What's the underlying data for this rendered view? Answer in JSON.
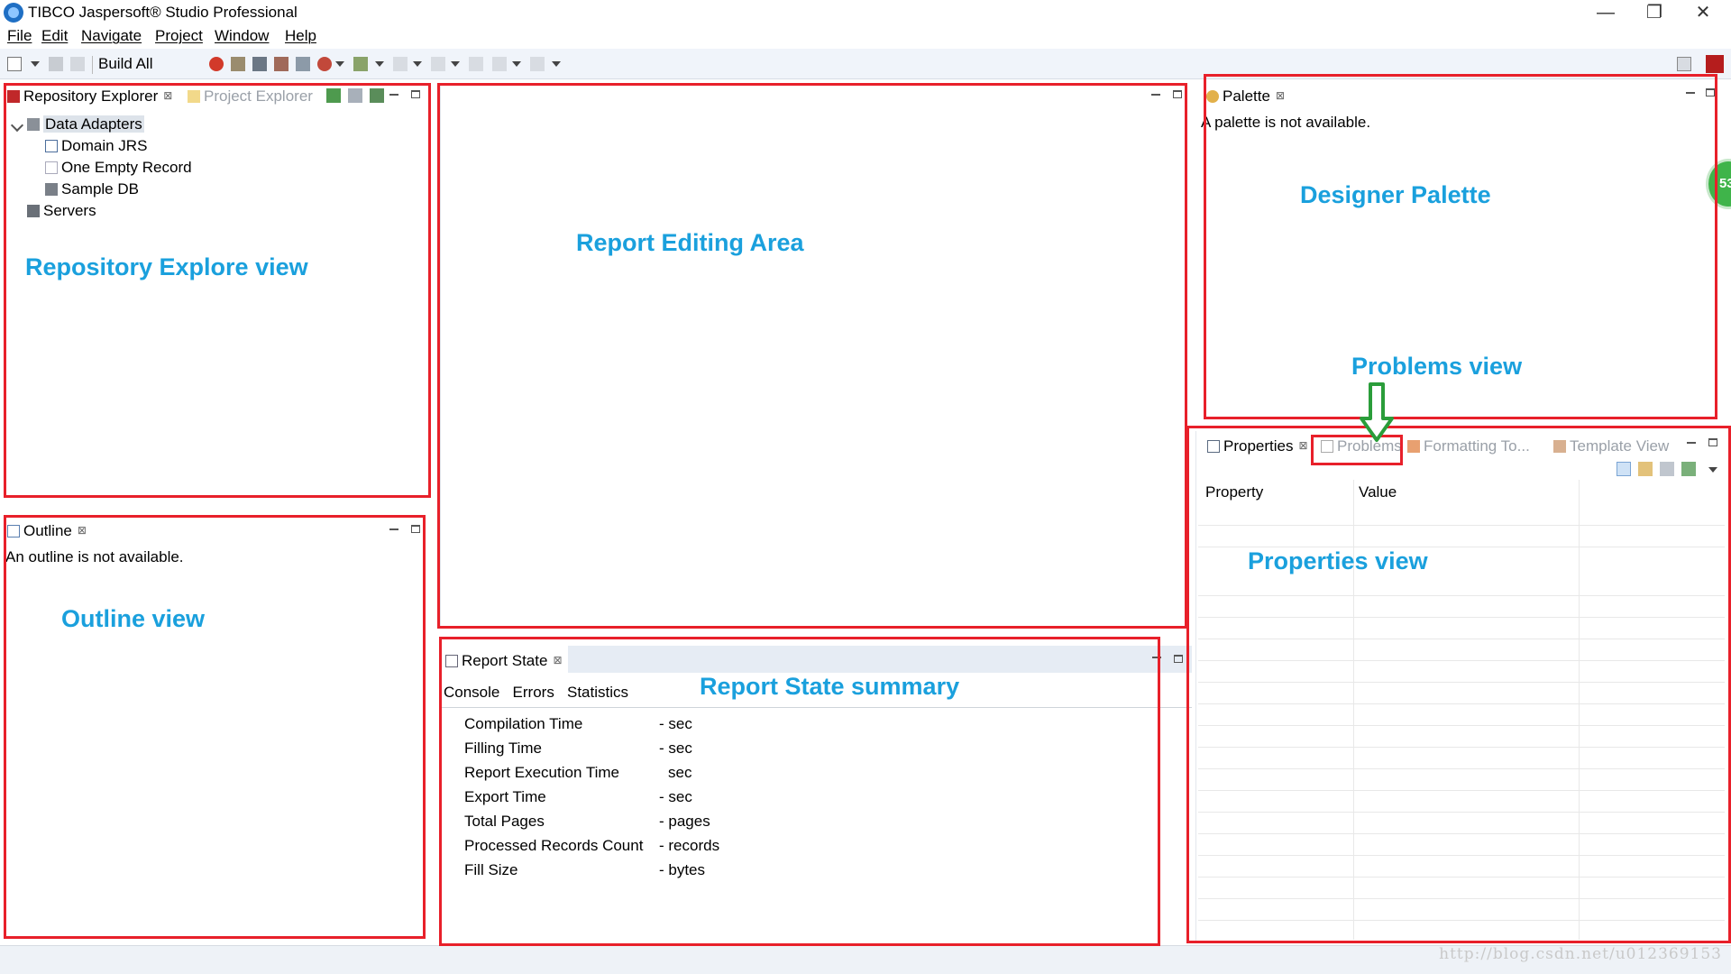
{
  "window": {
    "title": "TIBCO Jaspersoft® Studio Professional",
    "controls": {
      "minimize": "—",
      "restore": "❐",
      "close": "✕"
    }
  },
  "menu": [
    "File",
    "Edit",
    "Navigate",
    "Project",
    "Window",
    "Help"
  ],
  "toolbar": {
    "build_all": "Build All"
  },
  "repository": {
    "tabs": {
      "active": "Repository Explorer",
      "inactive": "Project Explorer"
    },
    "tree": {
      "root": "Data Adapters",
      "children": [
        "Domain JRS",
        "One Empty Record",
        "Sample DB"
      ],
      "servers": "Servers"
    }
  },
  "outline": {
    "tab": "Outline",
    "message": "An outline is not available."
  },
  "palette": {
    "tab": "Palette",
    "message": "A palette is not available."
  },
  "report_state": {
    "tab": "Report State",
    "subtabs": [
      "Console",
      "Errors",
      "Statistics"
    ],
    "rows": [
      {
        "label": "Compilation Time",
        "value": "- sec"
      },
      {
        "label": "Filling Time",
        "value": "- sec"
      },
      {
        "label": "Report Execution Time",
        "value": "sec"
      },
      {
        "label": "Export Time",
        "value": "- sec"
      },
      {
        "label": "Total Pages",
        "value": "- pages"
      },
      {
        "label": "Processed Records Count",
        "value": "- records"
      },
      {
        "label": "Fill Size",
        "value": "- bytes"
      }
    ]
  },
  "properties": {
    "tabs": [
      "Properties",
      "Problems",
      "Formatting To...",
      "Template View"
    ],
    "columns": [
      "Property",
      "Value"
    ]
  },
  "annotations": {
    "repository": "Repository Explore view",
    "editing": "Report Editing Area",
    "palette": "Designer Palette",
    "problems": "Problems view",
    "outline": "Outline view",
    "report_state": "Report State summary",
    "properties": "Properties view"
  },
  "floating_badge": "53",
  "watermark": "http://blog.csdn.net/u012369153",
  "colors": {
    "annotation_text": "#1aa0dd",
    "annotation_box": "#e8202a",
    "arrow": "#2a9d3a"
  }
}
